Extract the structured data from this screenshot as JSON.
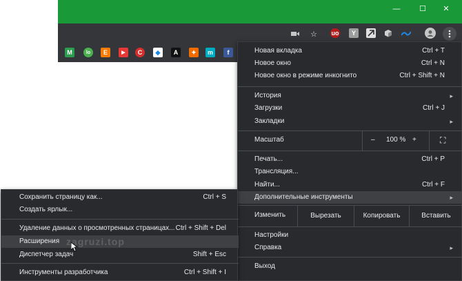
{
  "window": {
    "titlebar_color": "#1a9939",
    "controls": [
      "—",
      "☐",
      "✕"
    ]
  },
  "toolbar": {
    "icons": [
      "camera-icon",
      "star-icon",
      "ublock-icon",
      "yandex-icon",
      "extension-icon",
      "cube-icon",
      "wave-icon",
      "profile-avatar",
      "more-menu-icon"
    ],
    "ext_labels": {
      "ublock": "uo",
      "yandex": "Y"
    }
  },
  "bookmarks": {
    "items": [
      {
        "name": "bookmark-m-green",
        "glyph": "M",
        "color": "#2a9d4f"
      },
      {
        "name": "bookmark-lo",
        "glyph": "lo",
        "color": "#4caf50"
      },
      {
        "name": "bookmark-e",
        "glyph": "E",
        "color": "#f57c00"
      },
      {
        "name": "bookmark-youtube",
        "glyph": "▶",
        "color": "#e53935"
      },
      {
        "name": "bookmark-c-red",
        "glyph": "C",
        "color": "#d32f2f"
      },
      {
        "name": "bookmark-pin",
        "glyph": "◆",
        "color": "#1e88e5"
      },
      {
        "name": "bookmark-a",
        "glyph": "A",
        "color": "#111111"
      },
      {
        "name": "bookmark-orange",
        "glyph": "✦",
        "color": "#ef6c00"
      },
      {
        "name": "bookmark-m-teal",
        "glyph": "m",
        "color": "#00acc1"
      },
      {
        "name": "bookmark-facebook",
        "glyph": "f",
        "color": "#3b5998"
      }
    ]
  },
  "menu": {
    "new_tab": {
      "label": "Новая вкладка",
      "shortcut": "Ctrl + T"
    },
    "new_window": {
      "label": "Новое окно",
      "shortcut": "Ctrl + N"
    },
    "incognito": {
      "label": "Новое окно в режиме инкогнито",
      "shortcut": "Ctrl + Shift + N"
    },
    "history": {
      "label": "История"
    },
    "downloads": {
      "label": "Загрузки",
      "shortcut": "Ctrl + J"
    },
    "bookmarks": {
      "label": "Закладки"
    },
    "zoom": {
      "label": "Масштаб",
      "minus": "–",
      "value": "100 %",
      "plus": "+",
      "fullscreen": "⛶"
    },
    "print": {
      "label": "Печать...",
      "shortcut": "Ctrl + P"
    },
    "cast": {
      "label": "Трансляция..."
    },
    "find": {
      "label": "Найти...",
      "shortcut": "Ctrl + F"
    },
    "more_tools": {
      "label": "Дополнительные инструменты"
    },
    "edit": {
      "label": "Изменить",
      "cut": "Вырезать",
      "copy": "Копировать",
      "paste": "Вставить"
    },
    "settings": {
      "label": "Настройки"
    },
    "help": {
      "label": "Справка"
    },
    "exit": {
      "label": "Выход"
    }
  },
  "submenu": {
    "save_page": {
      "label": "Сохранить страницу как...",
      "shortcut": "Ctrl + S"
    },
    "create_shortcut": {
      "label": "Создать ярлык..."
    },
    "clear_data": {
      "label": "Удаление данных о просмотренных страницах...",
      "shortcut": "Ctrl + Shift + Del"
    },
    "extensions": {
      "label": "Расширения"
    },
    "task_manager": {
      "label": "Диспетчер задач",
      "shortcut": "Shift + Esc"
    },
    "dev_tools": {
      "label": "Инструменты разработчика",
      "shortcut": "Ctrl + Shift + I"
    }
  },
  "watermark": "zagruzi.top"
}
